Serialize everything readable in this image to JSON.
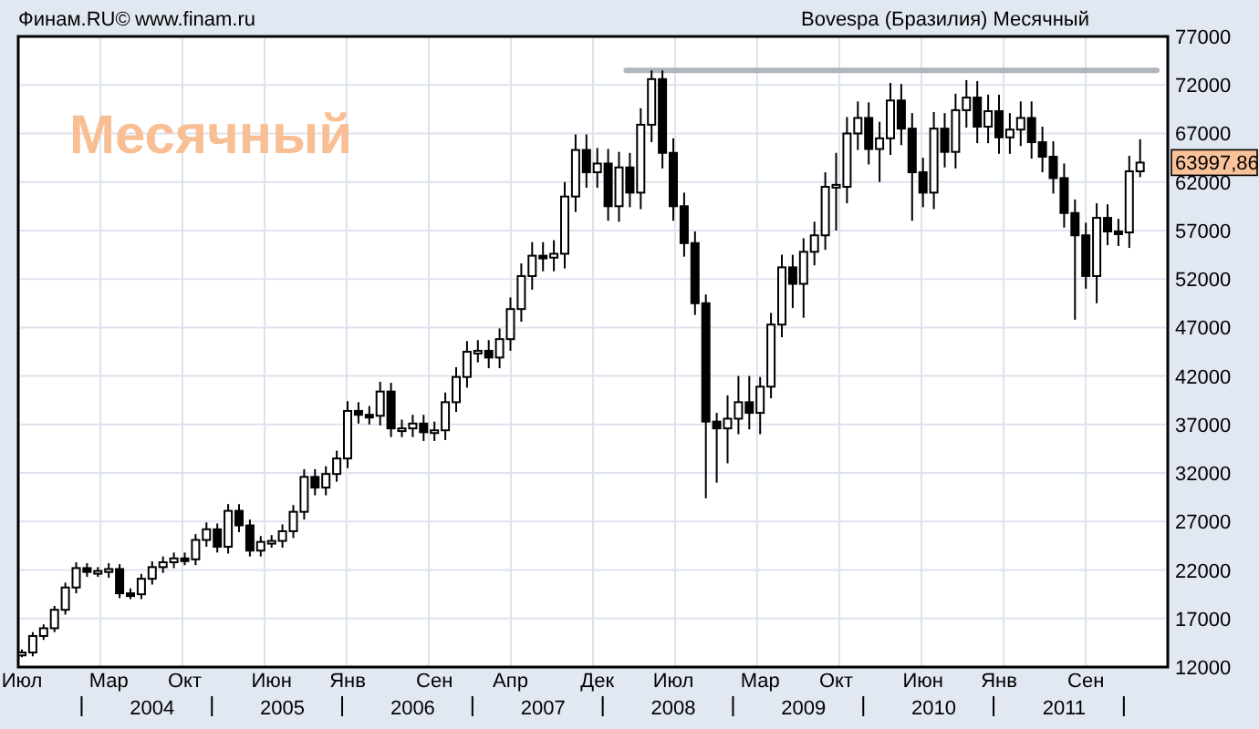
{
  "header": {
    "source": "Финам.RU©",
    "url": "www.finam.ru",
    "title": "Bovespa (Бразилия) Месячный"
  },
  "chart": {
    "period_label": "Месячный",
    "last_price": "63997,86",
    "year_labels": [
      "2004",
      "2005",
      "2006",
      "2007",
      "2008",
      "2009",
      "2010",
      "2011"
    ],
    "chart_data": {
      "type": "candlestick",
      "ylim": [
        12000,
        77000
      ],
      "grid": true,
      "yticks": [
        12000,
        17000,
        22000,
        27000,
        32000,
        37000,
        42000,
        47000,
        52000,
        57000,
        62000,
        67000,
        72000,
        77000
      ],
      "categories": [
        "Июл",
        null,
        null,
        null,
        null,
        null,
        null,
        null,
        "Мар",
        null,
        null,
        null,
        null,
        null,
        null,
        "Окт",
        null,
        null,
        null,
        null,
        null,
        null,
        null,
        "Июн",
        null,
        null,
        null,
        null,
        null,
        null,
        "Янв",
        null,
        null,
        null,
        null,
        null,
        null,
        null,
        "Сен",
        null,
        null,
        null,
        null,
        null,
        null,
        "Апр",
        null,
        null,
        null,
        null,
        null,
        null,
        null,
        "Дек",
        null,
        null,
        null,
        null,
        null,
        null,
        "Июл",
        null,
        null,
        null,
        null,
        null,
        null,
        null,
        "Мар",
        null,
        null,
        null,
        null,
        null,
        null,
        "Окт",
        null,
        null,
        null,
        null,
        null,
        null,
        null,
        "Июн",
        null,
        null,
        null,
        null,
        null,
        null,
        "Янв",
        null,
        null,
        null,
        null,
        null,
        null,
        null,
        "Сен",
        null,
        null,
        null,
        null,
        null
      ],
      "ohlc": [
        [
          13200,
          13800,
          13000,
          13500
        ],
        [
          13500,
          15600,
          13100,
          15200
        ],
        [
          15200,
          16400,
          14800,
          16000
        ],
        [
          16000,
          18300,
          15600,
          17900
        ],
        [
          17900,
          20700,
          17400,
          20200
        ],
        [
          20200,
          22800,
          19600,
          22200
        ],
        [
          22200,
          22700,
          21300,
          21800
        ],
        [
          21800,
          22300,
          21300,
          21900
        ],
        [
          21800,
          22700,
          21200,
          22100
        ],
        [
          22100,
          22600,
          19100,
          19600
        ],
        [
          19600,
          20100,
          19000,
          19500
        ],
        [
          19500,
          21600,
          19000,
          21100
        ],
        [
          21100,
          22900,
          20500,
          22300
        ],
        [
          22300,
          23400,
          21700,
          22800
        ],
        [
          22800,
          23800,
          22200,
          23200
        ],
        [
          23200,
          23800,
          22500,
          23100
        ],
        [
          23100,
          25700,
          22500,
          25100
        ],
        [
          25100,
          26900,
          24400,
          26200
        ],
        [
          26200,
          26800,
          23800,
          24400
        ],
        [
          24400,
          28800,
          23700,
          28100
        ],
        [
          28100,
          28800,
          25900,
          26600
        ],
        [
          26600,
          27200,
          23400,
          24000
        ],
        [
          24000,
          25500,
          23400,
          24900
        ],
        [
          24900,
          25600,
          24300,
          25000
        ],
        [
          25000,
          26700,
          24300,
          26000
        ],
        [
          26000,
          28700,
          25300,
          28000
        ],
        [
          28000,
          32400,
          27200,
          31600
        ],
        [
          31600,
          32400,
          29700,
          30500
        ],
        [
          30500,
          32700,
          29700,
          31900
        ],
        [
          31900,
          34300,
          31100,
          33500
        ],
        [
          33500,
          39400,
          32500,
          38400
        ],
        [
          38400,
          39300,
          37100,
          38000
        ],
        [
          38000,
          38900,
          37000,
          37900
        ],
        [
          37900,
          41400,
          36900,
          40400
        ],
        [
          40400,
          41300,
          35700,
          36600
        ],
        [
          36600,
          37500,
          35700,
          36600
        ],
        [
          36600,
          38000,
          35700,
          37100
        ],
        [
          37100,
          38000,
          35300,
          36200
        ],
        [
          36200,
          37300,
          35300,
          36400
        ],
        [
          36400,
          40300,
          35400,
          39300
        ],
        [
          39300,
          42900,
          38300,
          41900
        ],
        [
          41900,
          45600,
          40800,
          44500
        ],
        [
          44500,
          45700,
          43400,
          44600
        ],
        [
          44600,
          45700,
          42800,
          43900
        ],
        [
          43900,
          46900,
          42800,
          45800
        ],
        [
          45800,
          50100,
          44600,
          48900
        ],
        [
          48900,
          53600,
          47600,
          52300
        ],
        [
          52300,
          55800,
          50900,
          54400
        ],
        [
          54400,
          55800,
          52800,
          54200
        ],
        [
          54200,
          56000,
          52800,
          54600
        ],
        [
          54600,
          62000,
          53100,
          60500
        ],
        [
          60500,
          66900,
          58900,
          65300
        ],
        [
          65300,
          66900,
          61400,
          63000
        ],
        [
          63000,
          65500,
          61400,
          63900
        ],
        [
          63900,
          65400,
          58000,
          59500
        ],
        [
          59500,
          65100,
          57900,
          63500
        ],
        [
          63500,
          65000,
          59400,
          60900
        ],
        [
          60900,
          69600,
          59200,
          67900
        ],
        [
          67900,
          73500,
          66100,
          72600
        ],
        [
          72600,
          73500,
          63400,
          65000
        ],
        [
          65000,
          66500,
          58000,
          59500
        ],
        [
          59500,
          60900,
          54300,
          55700
        ],
        [
          55700,
          56900,
          48300,
          49500
        ],
        [
          49500,
          50400,
          29400,
          37300
        ],
        [
          37300,
          38200,
          31000,
          36600
        ],
        [
          36600,
          40000,
          33000,
          37600
        ],
        [
          37600,
          42000,
          36000,
          39300
        ],
        [
          39300,
          42000,
          36500,
          38200
        ],
        [
          38200,
          41900,
          36000,
          40900
        ],
        [
          40900,
          48500,
          39700,
          47300
        ],
        [
          47300,
          54500,
          46000,
          53200
        ],
        [
          53200,
          54500,
          49000,
          51500
        ],
        [
          51500,
          56200,
          48000,
          54800
        ],
        [
          54800,
          57900,
          53400,
          56500
        ],
        [
          56500,
          63000,
          55000,
          61500
        ],
        [
          61500,
          65000,
          57000,
          61700
        ],
        [
          61500,
          68700,
          59800,
          67000
        ],
        [
          67000,
          70300,
          65300,
          68600
        ],
        [
          68600,
          70200,
          63800,
          65400
        ],
        [
          65400,
          68200,
          62000,
          66500
        ],
        [
          66500,
          72200,
          64800,
          70400
        ],
        [
          70400,
          72100,
          65800,
          67500
        ],
        [
          67500,
          69100,
          58000,
          63000
        ],
        [
          63000,
          64500,
          59400,
          60900
        ],
        [
          60900,
          69200,
          59200,
          67500
        ],
        [
          67500,
          69100,
          63500,
          65100
        ],
        [
          65100,
          71100,
          63400,
          69400
        ],
        [
          69400,
          72500,
          67600,
          70700
        ],
        [
          70700,
          72400,
          66000,
          67700
        ],
        [
          67700,
          71000,
          66000,
          69300
        ],
        [
          69300,
          71000,
          64900,
          66600
        ],
        [
          66600,
          69100,
          64900,
          67400
        ],
        [
          67400,
          70300,
          65700,
          68600
        ],
        [
          68600,
          70300,
          64400,
          66100
        ],
        [
          66100,
          67700,
          63000,
          64600
        ],
        [
          64600,
          66200,
          60800,
          62400
        ],
        [
          62400,
          63900,
          57300,
          58800
        ],
        [
          58800,
          60200,
          47800,
          56500
        ],
        [
          56500,
          57800,
          51000,
          52300
        ],
        [
          52300,
          59800,
          49500,
          58300
        ],
        [
          58300,
          59700,
          55500,
          56900
        ],
        [
          56900,
          58200,
          55400,
          56800
        ],
        [
          56800,
          64700,
          55200,
          63100
        ],
        [
          63100,
          66400,
          62500,
          64000
        ]
      ],
      "ref_lines": [
        {
          "axis": "y",
          "value": 73500,
          "color": "#b0b6be"
        }
      ]
    }
  }
}
